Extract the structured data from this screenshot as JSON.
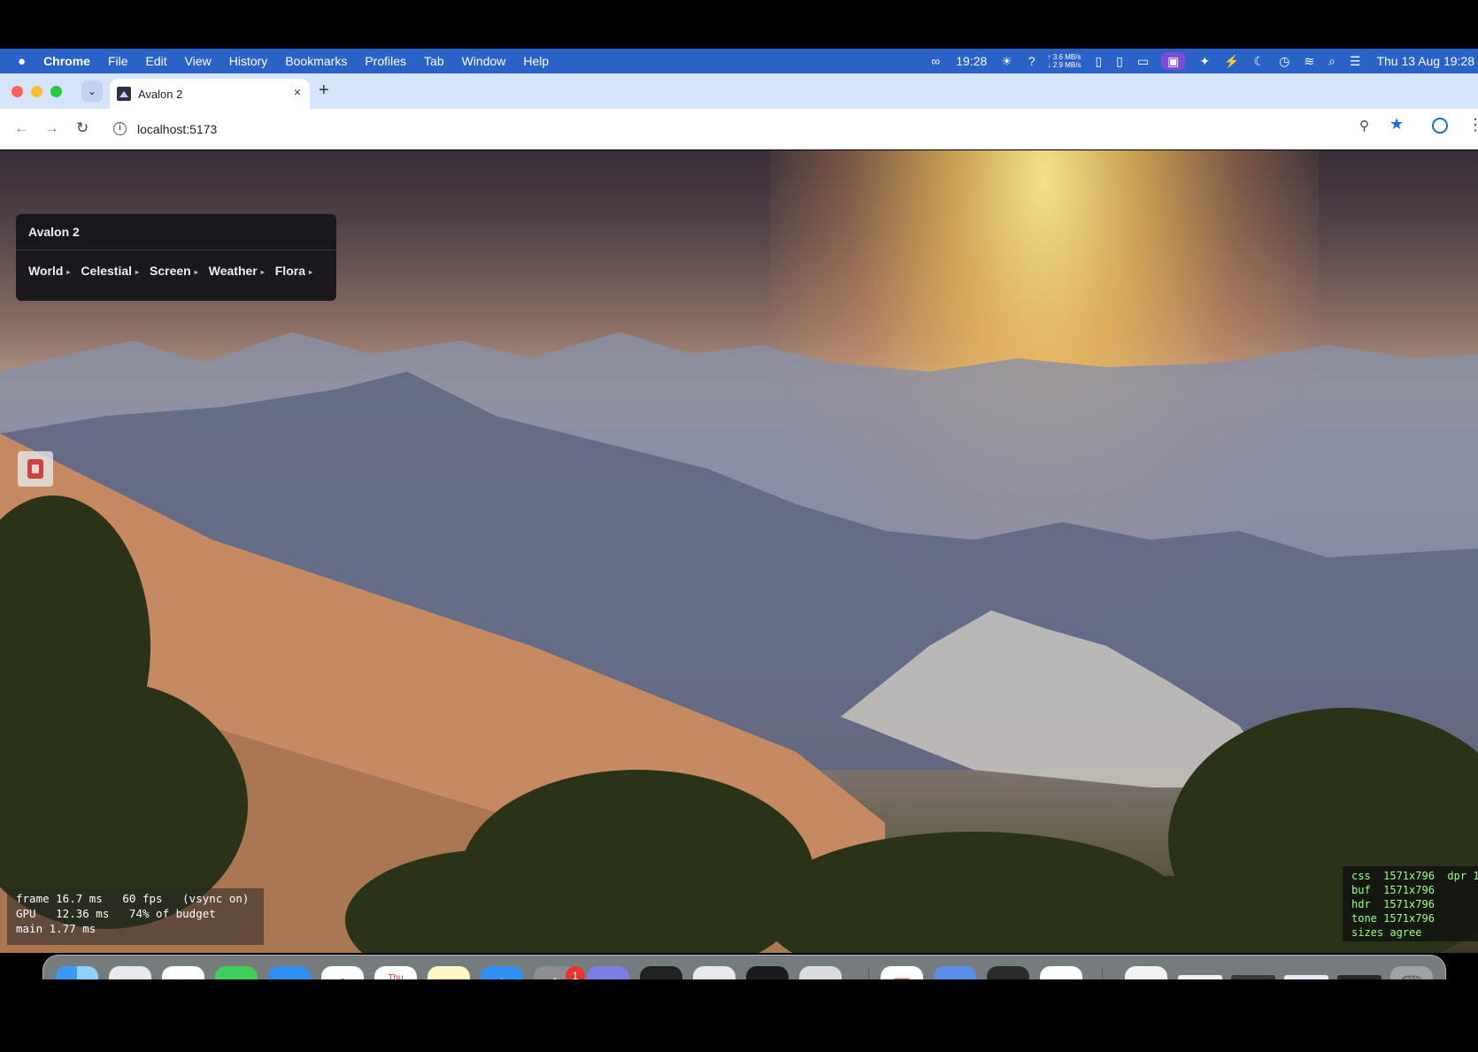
{
  "menubar": {
    "app_name": "Chrome",
    "items": [
      "File",
      "Edit",
      "View",
      "History",
      "Bookmarks",
      "Profiles",
      "Tab",
      "Window",
      "Help"
    ],
    "status": {
      "clock_short": "19:28",
      "question": "?",
      "net_up": "↑ 3.6 MB/s",
      "net_down": "↓ 2.9 MB/s",
      "datetime": "Thu 13 Aug  19:28"
    }
  },
  "tab": {
    "title": "Avalon 2",
    "close": "×",
    "new_tab": "+"
  },
  "toolbar": {
    "url": "localhost:5173",
    "back": "←",
    "forward": "→",
    "reload": "↻",
    "star": "★",
    "more": "⋮",
    "zoom": "⚲"
  },
  "panel": {
    "title": "Avalon 2",
    "menus": [
      {
        "label": "World"
      },
      {
        "label": "Celestial"
      },
      {
        "label": "Screen"
      },
      {
        "label": "Weather"
      },
      {
        "label": "Flora"
      }
    ],
    "caret": "▸"
  },
  "perf": {
    "line1": "frame 16.7 ms   60 fps   (vsync on)",
    "line2": "GPU   12.36 ms   74% of budget",
    "line3": "main 1.77 ms"
  },
  "resolution": {
    "css": "css  1571x796  dpr 1",
    "buf": "buf  1571x796",
    "hdr": "hdr  1571x796",
    "tone": "tone 1571x796",
    "agree": "sizes agree"
  },
  "dock": {
    "calendar_month": "Thu",
    "calendar_day": "13",
    "settings_badge": "1",
    "terminal_label": ">_"
  },
  "colors": {
    "menubar": "#2a62c7",
    "tabstrip": "#d5e3fb",
    "accent": "#1a6ad9",
    "panel_bg": "#141418",
    "overlay_text": "#9dff8a"
  }
}
